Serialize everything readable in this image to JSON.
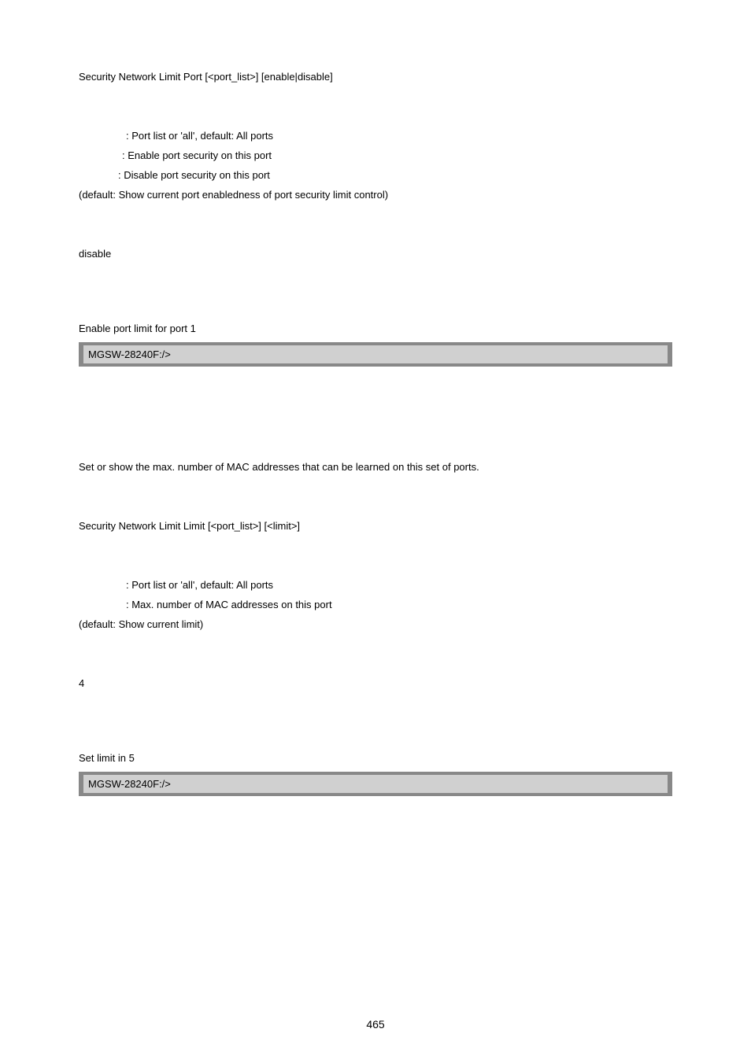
{
  "section1": {
    "syntax": "Security Network Limit Port [<port_list>] [enable|disable]",
    "param1": ": Port list or 'all', default: All ports",
    "param2": ": Enable port security on this port",
    "param3": ": Disable port security on this port",
    "default_note": "(default: Show current port enabledness of port security limit control)",
    "default_value": "disable",
    "example_note": "Enable port limit for port 1",
    "prompt": "MGSW-28240F:/>"
  },
  "section2": {
    "desc": "Set or show the max. number of MAC addresses that can be learned on this set of ports.",
    "syntax": "Security Network Limit Limit [<port_list>] [<limit>]",
    "param1": ": Port list or 'all', default: All ports",
    "param2": ": Max. number of MAC addresses on this port",
    "default_note": "(default: Show current limit)",
    "default_value": "4",
    "example_note": "Set limit in 5",
    "prompt": "MGSW-28240F:/>"
  },
  "page_number": "465"
}
